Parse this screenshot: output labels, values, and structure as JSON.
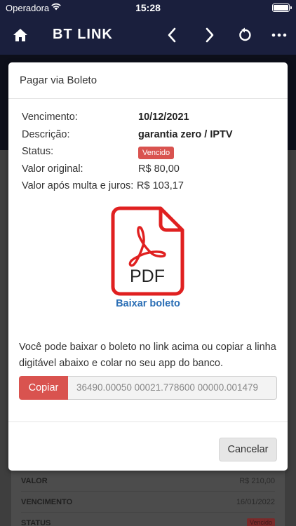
{
  "status_bar": {
    "carrier": "Operadora",
    "time": "15:28"
  },
  "app_bar": {
    "title": "BT LINK",
    "icons": [
      "home-icon",
      "chevron-left-icon",
      "chevron-right-icon",
      "refresh-icon",
      "more-icon"
    ]
  },
  "background": {
    "rows": [
      {
        "label": "VALOR",
        "value": "R$ 210,00"
      },
      {
        "label": "VENCIMENTO",
        "value": "16/01/2022"
      },
      {
        "label": "STATUS",
        "value": "Vencido"
      }
    ]
  },
  "modal": {
    "title": "Pagar via Boleto",
    "details": [
      {
        "label": "Vencimento:",
        "value": "10/12/2021"
      },
      {
        "label": "Descrição:",
        "value": "garantia zero / IPTV"
      },
      {
        "label": "Status:",
        "value": "Vencido"
      },
      {
        "label": "Valor original:",
        "value": "R$ 80,00"
      },
      {
        "label": "Valor após multa e juros:",
        "value": "R$ 103,17"
      }
    ],
    "pdf_label": "PDF",
    "download_link": "Baixar boleto",
    "help_text": "Você pode baixar o boleto no link acima ou copiar a linha digitável abaixo e colar no seu app do banco.",
    "copy_button": "Copiar",
    "barcode_line": "36490.00050 00021.778600 00000.001479",
    "cancel_button": "Cancelar",
    "colors": {
      "danger": "#d9534f",
      "link": "#2a6eb5",
      "appbar": "#1a1f3d"
    }
  }
}
